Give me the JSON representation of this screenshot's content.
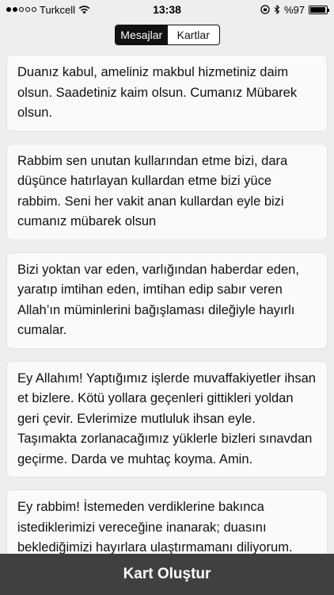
{
  "status_bar": {
    "carrier": "Turkcell",
    "time": "13:38",
    "battery": "%97",
    "battery_level": 0.97,
    "signal_bars_filled": 2,
    "signal_bars_total": 5
  },
  "tabs": [
    {
      "label": "Mesajlar",
      "active": true
    },
    {
      "label": "Kartlar",
      "active": false
    }
  ],
  "messages": [
    "Duanız kabul, ameliniz makbul hizmetiniz daim olsun. Saadetiniz kaim olsun. Cumanız Mübarek olsun.",
    "Rabbim sen unutan kullarından etme bizi, dara düşünce hatırlayan kullardan etme bizi yüce rabbim. Seni her vakit anan kullardan eyle bizi cumanız mübarek olsun",
    "Bizi yoktan var eden, varlığından haberdar eden, yaratıp imtihan eden, imtihan edip sabır veren Allah’ın müminlerini bağışlaması dileğiyle hayırlı cumalar.",
    "Ey Allahım! Yaptığımız işlerde muvaffakiyetler ihsan et bizlere. Kötü yollara geçenleri gittikleri yoldan geri çevir. Evlerimize mutluluk ihsan eyle. Taşımakta zorlanacağımız yüklerle bizleri sınavdan geçirme. Darda ve muhtaç koyma. Amin.",
    "Ey rabbim! İstemeden verdiklerine bakınca istediklerimizi vereceğine inanarak; duasını beklediğimizi hayırlara ulaştırmamanı diliyorum."
  ],
  "bottom_button": "Kart Oluştur"
}
